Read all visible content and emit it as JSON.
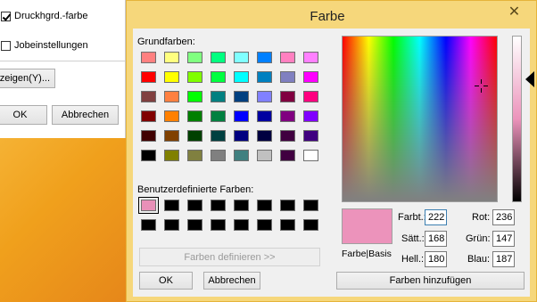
{
  "background": {
    "print_color_checkbox": {
      "label": "Druckhgrd.-farbe",
      "checked": true
    },
    "job_settings_checkbox": {
      "label": "Jobeinstellungen",
      "checked": false
    },
    "show_button_label": "zeigen(Y)...",
    "ok_label": "OK",
    "cancel_label": "Abbrechen"
  },
  "dialog": {
    "title": "Farbe",
    "close_symbol": "✕",
    "basic_colors_label": "Grundfarben:",
    "custom_colors_label": "Benutzerdefinierte Farben:",
    "define_colors_label": "Farben definieren >>",
    "ok_label": "OK",
    "cancel_label": "Abbrechen",
    "color_solid_label": "Farbe|Basis",
    "add_colors_label": "Farben hinzufügen",
    "fields": {
      "hue": {
        "label": "Farbt.:",
        "value": "222"
      },
      "sat": {
        "label": "Sätt.:",
        "value": "168"
      },
      "lum": {
        "label": "Hell.:",
        "value": "180"
      },
      "red": {
        "label": "Rot:",
        "value": "236"
      },
      "green": {
        "label": "Grün:",
        "value": "147"
      },
      "blue": {
        "label": "Blau:",
        "value": "187"
      }
    },
    "preview_color": "#ec93bb",
    "basic_colors": [
      [
        "#ff8080",
        "#ffff80",
        "#80ff80",
        "#00ff80",
        "#80ffff",
        "#0080ff",
        "#ff80c0",
        "#ff80ff"
      ],
      [
        "#ff0000",
        "#ffff00",
        "#80ff00",
        "#00ff40",
        "#00ffff",
        "#0080c0",
        "#8080c0",
        "#ff00ff"
      ],
      [
        "#804040",
        "#ff8040",
        "#00ff00",
        "#008080",
        "#004080",
        "#8080ff",
        "#800040",
        "#ff0080"
      ],
      [
        "#800000",
        "#ff8000",
        "#008000",
        "#008040",
        "#0000ff",
        "#0000a0",
        "#800080",
        "#8000ff"
      ],
      [
        "#400000",
        "#804000",
        "#004000",
        "#004040",
        "#000080",
        "#000040",
        "#400040",
        "#400080"
      ],
      [
        "#000000",
        "#808000",
        "#808040",
        "#808080",
        "#408080",
        "#c0c0c0",
        "#400040",
        "#ffffff"
      ]
    ],
    "custom_colors": [
      [
        "#e890b8",
        "#000000",
        "#000000",
        "#000000",
        "#000000",
        "#000000",
        "#000000",
        "#000000"
      ],
      [
        "#000000",
        "#000000",
        "#000000",
        "#000000",
        "#000000",
        "#000000",
        "#000000",
        "#000000"
      ]
    ]
  }
}
